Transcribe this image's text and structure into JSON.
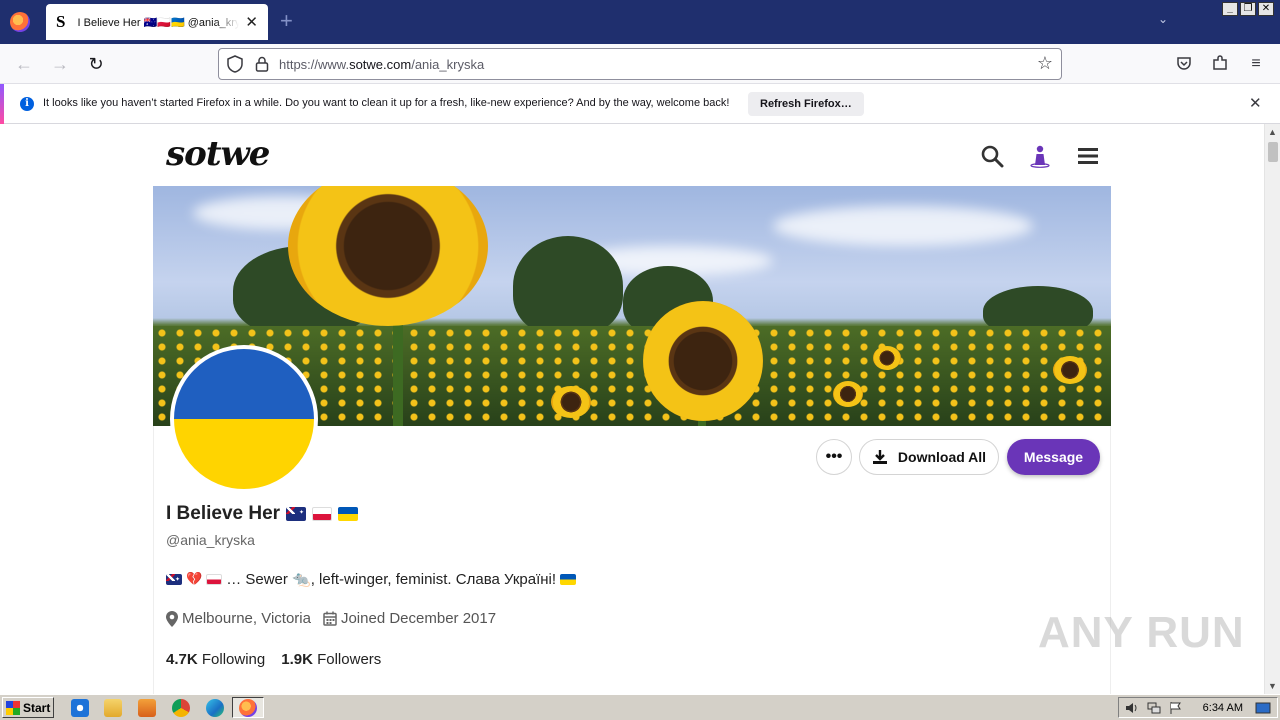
{
  "browser": {
    "tab_title": "I Believe Her 🇦🇺🇵🇱🇺🇦 @ania_kryska",
    "tab_favicon": "S",
    "new_tab_label": "+",
    "url_prefix": "https://www.",
    "url_domain": "sotwe.com",
    "url_path": "/ania_kryska",
    "notice_text": "It looks like you haven’t started Firefox in a while. Do you want to clean it up for a fresh, like-new experience? And by the way, welcome back!",
    "notice_button": "Refresh Firefox…"
  },
  "site": {
    "logo": "sotwe"
  },
  "profile": {
    "name": "I Believe Her",
    "handle": "@ania_kryska",
    "bio_text": "… Sewer 🐀, left-winger, feminist. Слава Україні!",
    "location": "Melbourne, Victoria",
    "joined": "Joined December 2017",
    "following_count": "4.7K",
    "following_label": "Following",
    "followers_count": "1.9K",
    "followers_label": "Followers",
    "more_label": "•••",
    "download_label": "Download All",
    "message_label": "Message"
  },
  "colors": {
    "accent": "#6a35b8",
    "firefox_titlebar": "#1f2f6e",
    "flag_ua_blue": "#1f5fc0",
    "flag_ua_yellow": "#ffd400"
  },
  "watermark": "ANY RUN",
  "taskbar": {
    "start_label": "Start",
    "clock": "6:34 AM"
  }
}
